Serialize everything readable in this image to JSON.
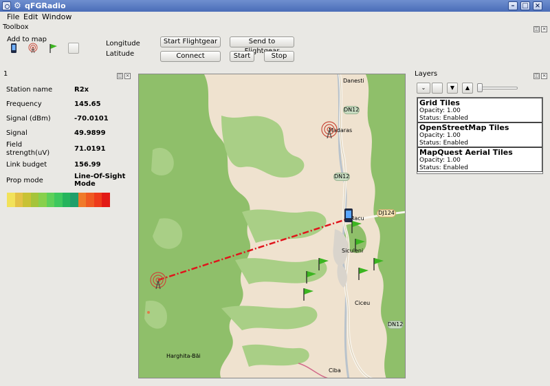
{
  "window": {
    "title": "qFGRadio"
  },
  "menu": {
    "file": "File",
    "edit": "Edit",
    "window": "Window"
  },
  "toolbox": {
    "title": "Toolbox",
    "add_to_map": "Add to map",
    "longitude_label": "Longitude",
    "latitude_label": "Latitude",
    "start_flightgear": "Start Flightgear",
    "send_to_flightgear": "Send to Flightgear",
    "connect": "Connect",
    "start": "Start",
    "stop": "Stop"
  },
  "station_panel": {
    "title": "1",
    "rows": [
      {
        "label": "Station name",
        "value": "R2x"
      },
      {
        "label": "Frequency",
        "value": "145.65"
      },
      {
        "label": "Signal (dBm)",
        "value": "-70.0101"
      },
      {
        "label": "Signal",
        "value": "49.9899"
      },
      {
        "label": "Field",
        "label2": "strength(uV)",
        "value": "71.0191"
      },
      {
        "label": "Link budget",
        "value": "156.99"
      },
      {
        "label": "Prop mode",
        "value": "Line-Of-Sight",
        "value2": "Mode"
      }
    ],
    "signal_colors": [
      "#f2e25a",
      "#e4c246",
      "#c8c235",
      "#a5c43a",
      "#88d04c",
      "#5ed05a",
      "#3ec85e",
      "#25b45c",
      "#1f9e6a",
      "#f07a2a",
      "#ef5a22",
      "#ee3b1b",
      "#e21a16"
    ]
  },
  "map": {
    "labels": {
      "danesti": "Danesti",
      "madaras": "Madaras",
      "dn12_top": "DN12",
      "dn12_mid": "DN12",
      "dj124": "DJ124",
      "racu": "Racu",
      "siculeni": "Siculeni",
      "ciceu": "Ciceu",
      "dn12_bottom": "DN12",
      "harghita": "Harghita-Băi",
      "ciba": "Ciba"
    },
    "colors": {
      "forest": "#8fbf6a",
      "land": "#efe2cf",
      "road": "#f8f5ee",
      "link": "#e0141b"
    }
  },
  "layers": {
    "title": "Layers",
    "items": [
      {
        "name": "Grid Tiles",
        "opacity": "Opacity: 1.00",
        "status": "Status: Enabled"
      },
      {
        "name": "OpenStreetMap Tiles",
        "opacity": "Opacity: 1.00",
        "status": "Status: Enabled"
      },
      {
        "name": "MapQuest Aerial Tiles",
        "opacity": "Opacity: 1.00",
        "status": "Status: Enabled"
      }
    ]
  }
}
